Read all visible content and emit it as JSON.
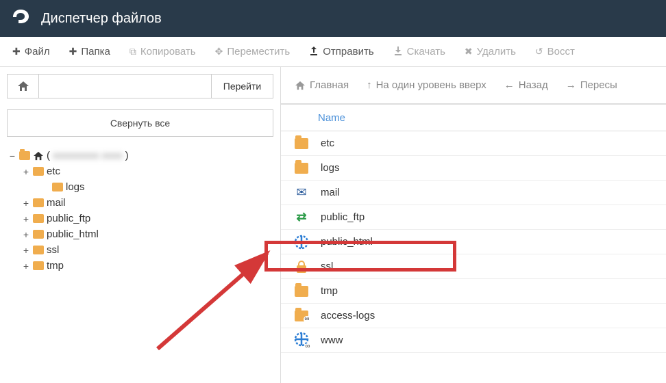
{
  "header": {
    "title": "Диспетчер файлов"
  },
  "toolbar": {
    "file": "Файл",
    "folder": "Папка",
    "copy": "Копировать",
    "move": "Переместить",
    "upload": "Отправить",
    "download": "Скачать",
    "delete": "Удалить",
    "restore": "Восст"
  },
  "sidebar": {
    "go": "Перейти",
    "collapse": "Свернуть все",
    "root_prefix": "(",
    "root_blurred": "xxxxxxxxx xxxx",
    "root_suffix": ")",
    "nodes": [
      {
        "label": "etc",
        "expandable": true
      },
      {
        "label": "logs",
        "expandable": false
      },
      {
        "label": "mail",
        "expandable": true
      },
      {
        "label": "public_ftp",
        "expandable": true
      },
      {
        "label": "public_html",
        "expandable": true
      },
      {
        "label": "ssl",
        "expandable": true
      },
      {
        "label": "tmp",
        "expandable": true
      }
    ]
  },
  "maintoolbar": {
    "home": "Главная",
    "up": "На один уровень вверх",
    "back": "Назад",
    "forward": "Пересы"
  },
  "table": {
    "header_name": "Name",
    "rows": [
      {
        "icon": "folder",
        "name": "etc"
      },
      {
        "icon": "folder",
        "name": "logs"
      },
      {
        "icon": "mail",
        "name": "mail"
      },
      {
        "icon": "ftp",
        "name": "public_ftp"
      },
      {
        "icon": "globe",
        "name": "public_html"
      },
      {
        "icon": "lock",
        "name": "ssl"
      },
      {
        "icon": "folder",
        "name": "tmp"
      },
      {
        "icon": "folder-link",
        "name": "access-logs"
      },
      {
        "icon": "globe-link",
        "name": "www"
      }
    ]
  }
}
